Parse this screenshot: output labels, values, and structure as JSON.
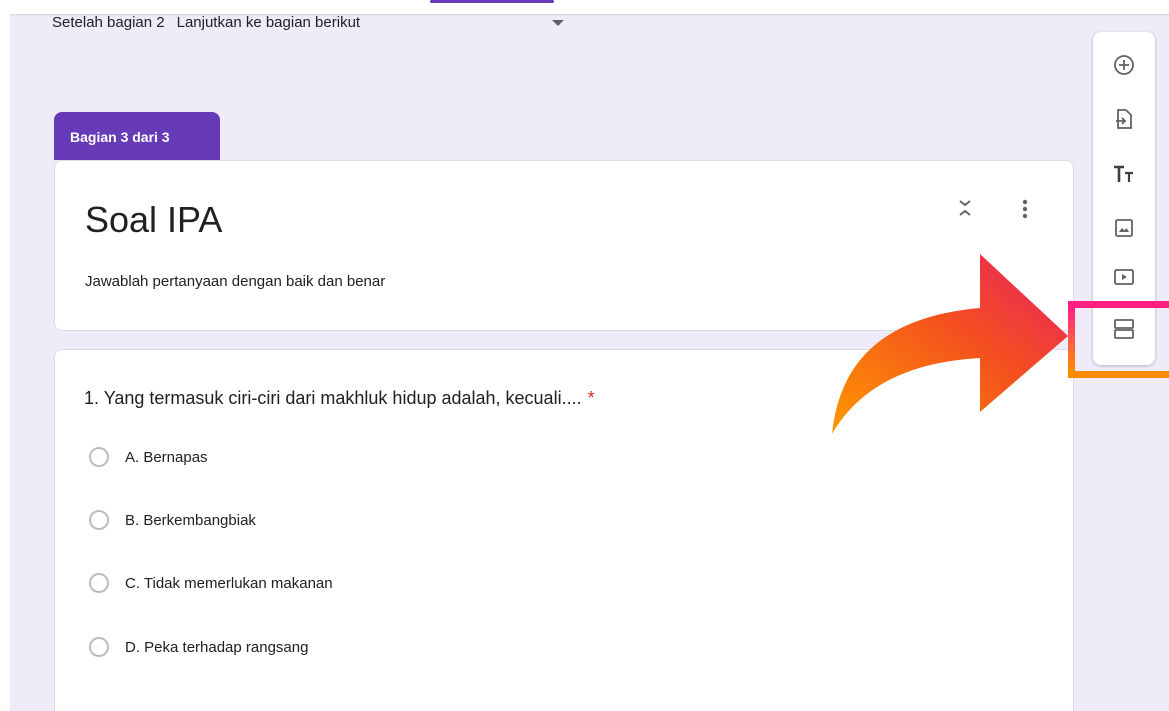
{
  "after_section": {
    "label": "Setelah bagian 2",
    "value": "Lanjutkan ke bagian berikut"
  },
  "section": {
    "tab_label": "Bagian 3 dari 3",
    "title": "Soal IPA",
    "description": "Jawablah pertanyaan dengan baik dan benar"
  },
  "question": {
    "text": "1. Yang termasuk ciri-ciri dari makhluk hidup adalah, kecuali....",
    "required_mark": "*",
    "options": [
      "A. Bernapas",
      "B. Berkembangbiak",
      "C. Tidak memerlukan makanan",
      "D. Peka terhadap rangsang"
    ]
  },
  "toolbar": {
    "items": [
      {
        "icon": "add-question-icon"
      },
      {
        "icon": "import-questions-icon"
      },
      {
        "icon": "add-title-icon"
      },
      {
        "icon": "add-image-icon"
      },
      {
        "icon": "add-video-icon"
      },
      {
        "icon": "add-section-icon"
      }
    ]
  },
  "colors": {
    "accent": "#673ab7",
    "background": "#f0ebf8",
    "required": "#d93025",
    "highlight_top": "#ff1f83",
    "highlight_bottom": "#ff8a00"
  }
}
